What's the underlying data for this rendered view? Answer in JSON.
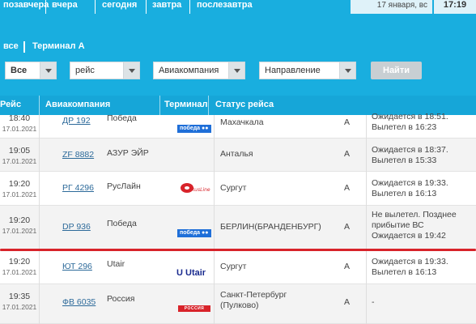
{
  "days": [
    "позавчера",
    "вчера",
    "сегодня",
    "завтра",
    "послезавтра"
  ],
  "date": "17 января, вс",
  "clock": "17:19",
  "terminal_filter": {
    "all": "все",
    "current": "Терминал А"
  },
  "filters": {
    "all": "Все",
    "flight_placeholder": "рейс",
    "airline": "Авиакомпания",
    "direction": "Направление",
    "find_button": "Найти"
  },
  "table": {
    "columns": [
      "Рейс",
      "Авиакомпания",
      "Терминал",
      "Статус рейса"
    ],
    "rows": [
      {
        "time": "18:40",
        "date": "17.01.2021",
        "flight": "ДР 192",
        "airline": "Победа",
        "logo": "pobeda-logo",
        "city": "Махачкала",
        "terminal": "А",
        "status": "Ожидается в 18:51.\nВылетел в 16:23"
      },
      {
        "time": "19:05",
        "date": "17.01.2021",
        "flight": "ZF 8882",
        "airline": "АЗУР ЭЙР",
        "logo": "",
        "city": "Анталья",
        "terminal": "А",
        "status": "Ожидается в 18:37.\nВылетел в 15:33"
      },
      {
        "time": "19:20",
        "date": "17.01.2021",
        "flight": "РГ 4296",
        "airline": "РусЛайн",
        "logo": "rusline-logo",
        "city": "Сургут",
        "terminal": "А",
        "status": "Ожидается в 19:33.\nВылетел в 16:13"
      },
      {
        "time": "19:20",
        "date": "17.01.2021",
        "flight": "DP 936",
        "airline": "Победа",
        "logo": "pobeda-logo",
        "city": "БЕРЛИН(БРАНДЕНБУРГ)",
        "terminal": "А",
        "status": "Не вылетел. Позднее\nприбытие ВС\nОжидается в 19:42"
      },
      {
        "time": "19:20",
        "date": "17.01.2021",
        "flight": "ЮТ 296",
        "airline": "Utair",
        "logo": "utair-logo",
        "city": "Сургут",
        "terminal": "А",
        "status": "Ожидается в 19:33.\nВылетел в 16:13"
      },
      {
        "time": "19:35",
        "date": "17.01.2021",
        "flight": "ФВ 6035",
        "airline": "Россия",
        "logo": "rossiya-logo",
        "city": "Санкт-Петербург\n(Пулково)",
        "terminal": "А",
        "status": "-"
      }
    ]
  },
  "logos": {
    "pobeda": "победа",
    "utair": "Utair",
    "rossiya": "РОССИЯ"
  },
  "colors": {
    "brand_blue": "#19aedf",
    "highlight_red": "#d8232a",
    "link_blue": "#2d6a9a"
  }
}
